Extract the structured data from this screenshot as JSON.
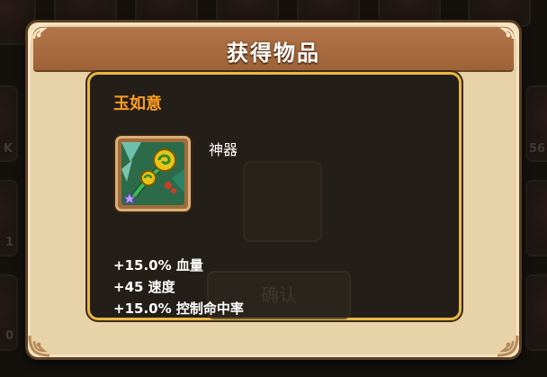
{
  "dialog": {
    "title": "获得物品"
  },
  "item": {
    "name": "玉如意",
    "rarity": "神器",
    "icon": "jade-ruyi-scepter-icon",
    "rarity_stars": 1,
    "stats": [
      "+15.0% 血量",
      "+45 速度",
      "+15.0% 控制命中率"
    ]
  },
  "background": {
    "slot_counts": [
      "K",
      "56",
      "1",
      "0"
    ],
    "ghost_button_label": "确认"
  },
  "colors": {
    "item_name": "#ff9d1e",
    "panel_border": "#e8b844",
    "title_bar": "#a86c40"
  }
}
